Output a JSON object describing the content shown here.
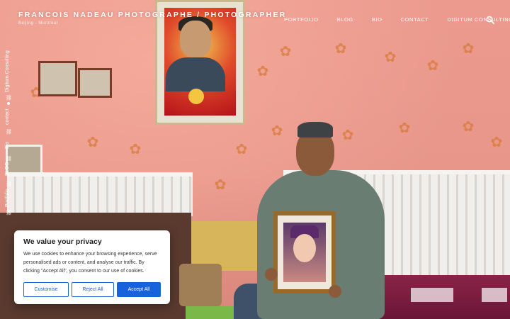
{
  "header": {
    "site_title": "FRANCOIS NADEAU PHOTOGRAPHE / PHOTOGRAPHER",
    "site_subtitle": "Beijing - Montreal"
  },
  "nav": {
    "items": [
      "PORTFOLIO",
      "BLOG",
      "BIO",
      "CONTACT",
      "DIGITUM CONSULTING"
    ],
    "search_icon": "search-icon"
  },
  "sidebar": {
    "items": [
      "Portfolio",
      "BLOG",
      "Bio",
      "contact",
      "Digitum Consulting"
    ]
  },
  "cookie": {
    "title": "We value your privacy",
    "body": "We use cookies to enhance your browsing experience, serve personalised ads or content, and analyse our traffic. By clicking \"Accept All\", you consent to our use of cookies.",
    "customise_label": "Customise",
    "reject_label": "Reject All",
    "accept_label": "Accept All",
    "accent_color": "#1863dc"
  }
}
